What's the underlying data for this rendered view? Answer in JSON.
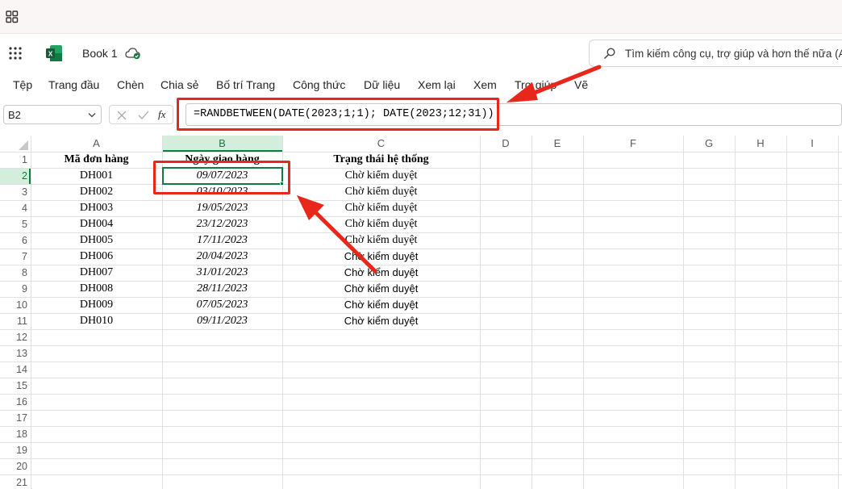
{
  "app": {
    "title": "Book 1",
    "search_placeholder": "Tìm kiếm công cụ, trợ giúp và hơn thế nữa (Alt + Q)"
  },
  "ribbon": {
    "tabs": [
      "Tệp",
      "Trang đầu",
      "Chèn",
      "Chia sẻ",
      "Bố trí Trang",
      "Công thức",
      "Dữ liệu",
      "Xem lại",
      "Xem",
      "Trợ giúp",
      "Vẽ"
    ]
  },
  "formula_bar": {
    "name_box": "B2",
    "fx": "fx",
    "formula": "=RANDBETWEEN(DATE(2023;1;1); DATE(2023;12;31))"
  },
  "grid": {
    "columns": [
      "A",
      "B",
      "C",
      "D",
      "E",
      "F",
      "G",
      "H",
      "I"
    ],
    "row_numbers": [
      "1",
      "2",
      "3",
      "4",
      "5",
      "6",
      "7",
      "8",
      "9",
      "10",
      "11",
      "12",
      "13",
      "14",
      "15",
      "16",
      "17",
      "18",
      "19",
      "20",
      "21"
    ],
    "selected_cell": "B2",
    "header_row": [
      "Mã đơn hàng",
      "Ngày giao hàng",
      "Trạng thái hệ thống"
    ],
    "rows": [
      [
        "DH001",
        "09/07/2023",
        "Chờ kiểm duyệt"
      ],
      [
        "DH002",
        "03/10/2023",
        "Chờ kiểm duyệt"
      ],
      [
        "DH003",
        "19/05/2023",
        "Chờ kiểm duyệt"
      ],
      [
        "DH004",
        "23/12/2023",
        "Chờ kiểm duyệt"
      ],
      [
        "DH005",
        "17/11/2023",
        "Chờ kiểm duyệt"
      ],
      [
        "DH006",
        "20/04/2023",
        "Chờ kiểm duyệt"
      ],
      [
        "DH007",
        "31/01/2023",
        "Chờ kiểm duyệt"
      ],
      [
        "DH008",
        "28/11/2023",
        "Chờ kiểm duyệt"
      ],
      [
        "DH009",
        "07/05/2023",
        "Chờ kiểm duyệt"
      ],
      [
        "DH010",
        "09/11/2023",
        "Chờ kiểm duyệt"
      ]
    ]
  },
  "colors": {
    "accent_green": "#107c41",
    "annotation_red": "#e8261a"
  }
}
